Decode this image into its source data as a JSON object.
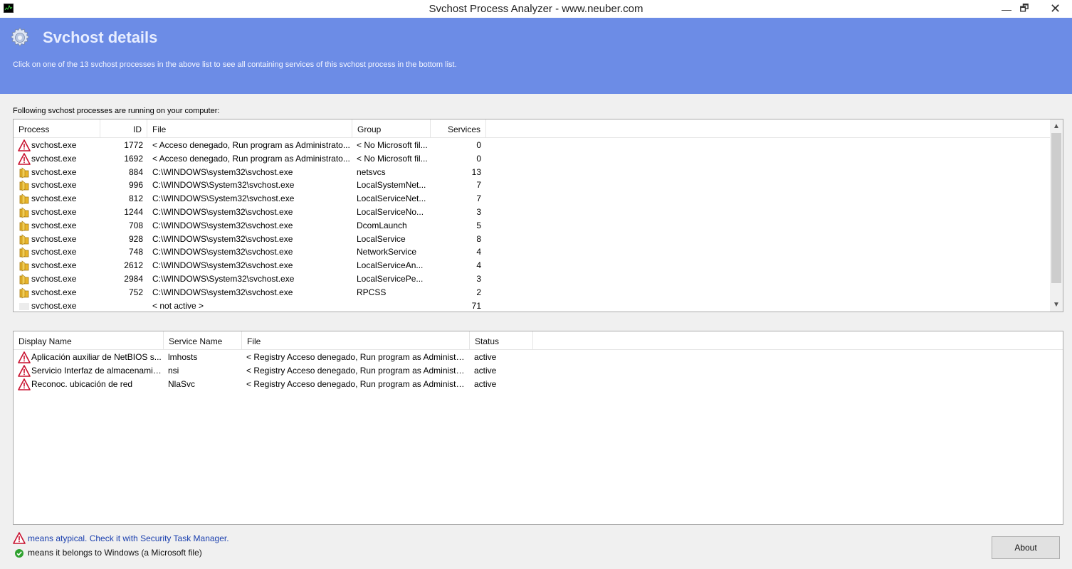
{
  "window": {
    "title": "Svchost Process Analyzer - www.neuber.com",
    "minimize": "—",
    "maximize": "🗗",
    "close": "✕"
  },
  "header": {
    "title": "Svchost details",
    "description": "Click on one of the 13 svchost processes in the above list to see all containing services of this svchost process in the bottom list."
  },
  "processes": {
    "intro": "Following svchost processes are running on your computer:",
    "columns": {
      "process": "Process",
      "id": "ID",
      "file": "File",
      "group": "Group",
      "services": "Services"
    },
    "rows": [
      {
        "icon": "warning-icon",
        "process": "svchost.exe",
        "id": "1772",
        "file": "< Acceso denegado, Run program as Administrato...",
        "group": "< No Microsoft fil...",
        "services": "0"
      },
      {
        "icon": "warning-icon",
        "process": "svchost.exe",
        "id": "1692",
        "file": "< Acceso denegado, Run program as Administrato...",
        "group": "< No Microsoft fil...",
        "services": "0"
      },
      {
        "icon": "folder-icon",
        "process": "svchost.exe",
        "id": "884",
        "file": "C:\\WINDOWS\\system32\\svchost.exe",
        "group": "netsvcs",
        "services": "13"
      },
      {
        "icon": "folder-icon",
        "process": "svchost.exe",
        "id": "996",
        "file": "C:\\WINDOWS\\System32\\svchost.exe",
        "group": "LocalSystemNet...",
        "services": "7"
      },
      {
        "icon": "folder-icon",
        "process": "svchost.exe",
        "id": "812",
        "file": "C:\\WINDOWS\\System32\\svchost.exe",
        "group": "LocalServiceNet...",
        "services": "7"
      },
      {
        "icon": "folder-icon",
        "process": "svchost.exe",
        "id": "1244",
        "file": "C:\\WINDOWS\\system32\\svchost.exe",
        "group": "LocalServiceNo...",
        "services": "3"
      },
      {
        "icon": "folder-icon",
        "process": "svchost.exe",
        "id": "708",
        "file": "C:\\WINDOWS\\system32\\svchost.exe",
        "group": "DcomLaunch",
        "services": "5"
      },
      {
        "icon": "folder-icon",
        "process": "svchost.exe",
        "id": "928",
        "file": "C:\\WINDOWS\\system32\\svchost.exe",
        "group": "LocalService",
        "services": "8"
      },
      {
        "icon": "folder-icon",
        "process": "svchost.exe",
        "id": "748",
        "file": "C:\\WINDOWS\\system32\\svchost.exe",
        "group": "NetworkService",
        "services": "4"
      },
      {
        "icon": "folder-icon",
        "process": "svchost.exe",
        "id": "2612",
        "file": "C:\\WINDOWS\\system32\\svchost.exe",
        "group": "LocalServiceAn...",
        "services": "4"
      },
      {
        "icon": "folder-icon",
        "process": "svchost.exe",
        "id": "2984",
        "file": "C:\\WINDOWS\\System32\\svchost.exe",
        "group": "LocalServicePe...",
        "services": "3"
      },
      {
        "icon": "folder-icon",
        "process": "svchost.exe",
        "id": "752",
        "file": "C:\\WINDOWS\\system32\\svchost.exe",
        "group": "RPCSS",
        "services": "2"
      },
      {
        "icon": "inactive-icon",
        "process": "svchost.exe",
        "id": "",
        "file": "< not active >",
        "group": "",
        "services": "71"
      }
    ]
  },
  "services": {
    "columns": {
      "display_name": "Display Name",
      "service_name": "Service Name",
      "file": "File",
      "status": "Status"
    },
    "rows": [
      {
        "icon": "warning-icon",
        "display_name": "Aplicación auxiliar de NetBIOS s...",
        "service_name": "lmhosts",
        "file": "< Registry Acceso denegado, Run program as Administra...",
        "status": "active"
      },
      {
        "icon": "warning-icon",
        "display_name": "Servicio Interfaz de almacenamie...",
        "service_name": "nsi",
        "file": "< Registry Acceso denegado, Run program as Administra...",
        "status": "active"
      },
      {
        "icon": "warning-icon",
        "display_name": "Reconoc. ubicación de red",
        "service_name": "NlaSvc",
        "file": "< Registry Acceso denegado, Run program as Administra...",
        "status": "active"
      }
    ]
  },
  "legend": {
    "atypical": "means atypical. Check it with Security Task Manager.",
    "windows": "means it belongs to Windows (a Microsoft file)"
  },
  "about_button": "About",
  "colors": {
    "header_bg": "#6c8ce6",
    "legend_link": "#1a3fae",
    "warning_red": "#c8102e"
  }
}
